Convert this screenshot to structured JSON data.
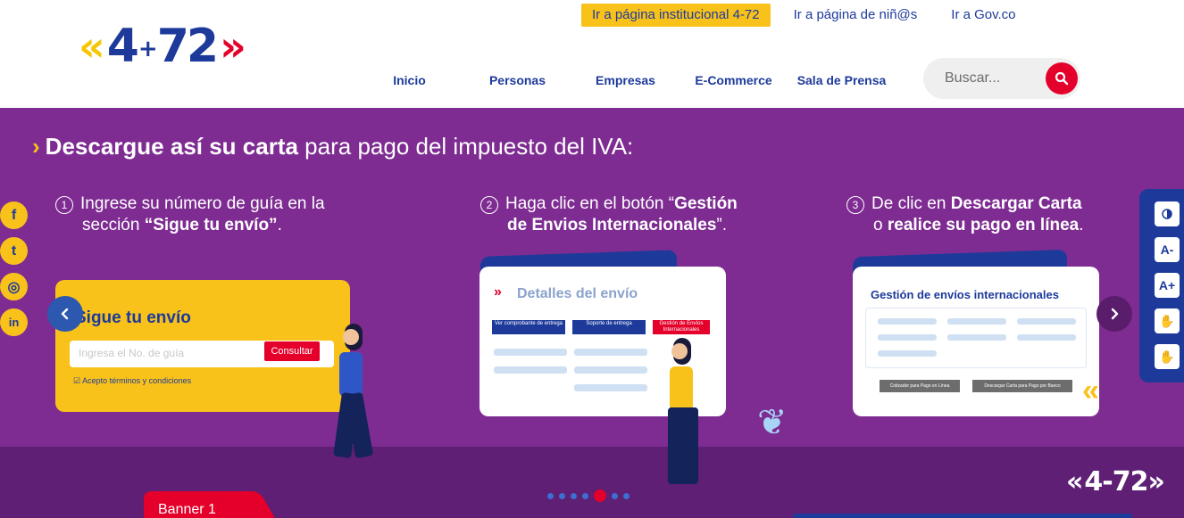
{
  "header": {
    "logo_text": "4-72",
    "top_links": {
      "institutional": "Ir a página institucional 4-72",
      "kids": "Ir a página de niñ@s",
      "gov": "Ir a Gov.co"
    },
    "nav": [
      "Inicio",
      "Personas",
      "Empresas",
      "E-Commerce",
      "Sala de Prensa"
    ],
    "search": {
      "placeholder": "Buscar..."
    }
  },
  "banner": {
    "title_bold": "Descargue así su carta",
    "title_rest": " para pago del impuesto del IVA:",
    "steps": [
      {
        "num": "1",
        "line1": "Ingrese su número de guía en la",
        "line2_pre": "sección ",
        "line2_bold": "“Sigue tu envío”",
        "line2_post": "."
      },
      {
        "num": "2",
        "line1_pre": "Haga clic en el botón “",
        "line1_bold": "Gestión",
        "line2_bold": "de Envios Internacionales",
        "line2_post": "”."
      },
      {
        "num": "3",
        "line1_pre": "De clic en ",
        "line1_bold": "Descargar Carta",
        "line2_pre": "o ",
        "line2_bold": "realice su pago en línea",
        "line2_post": "."
      }
    ],
    "card1": {
      "title": "Sigue tu envío",
      "input_placeholder": "Ingresa el No. de guía",
      "button": "Consultar",
      "terms": "☑ Acepto términos y condiciones"
    },
    "card2": {
      "title": "Detalles del envío",
      "tags": [
        "Ver comprobante de entrega",
        "Soporte de entrega",
        "Gestión de Envíos Internacionales"
      ]
    },
    "card3": {
      "title": "Gestión de envíos internacionales",
      "buttons": [
        "Cotizador para Pago en Línea",
        "Descargar Carta para Pago por Banco"
      ]
    },
    "watermark": "4-72",
    "tab_label": "Banner 1",
    "dots_total": 7,
    "dot_active": 4
  },
  "social": [
    "f",
    "t",
    "◎",
    "in"
  ],
  "accessibility": [
    "contrast",
    "A-",
    "A+",
    "sign-language",
    "sign-language"
  ],
  "colors": {
    "brand_blue": "#1d3a9b",
    "brand_yellow": "#f8c21b",
    "brand_red": "#e4002b",
    "banner_purple": "#7e2c92"
  }
}
